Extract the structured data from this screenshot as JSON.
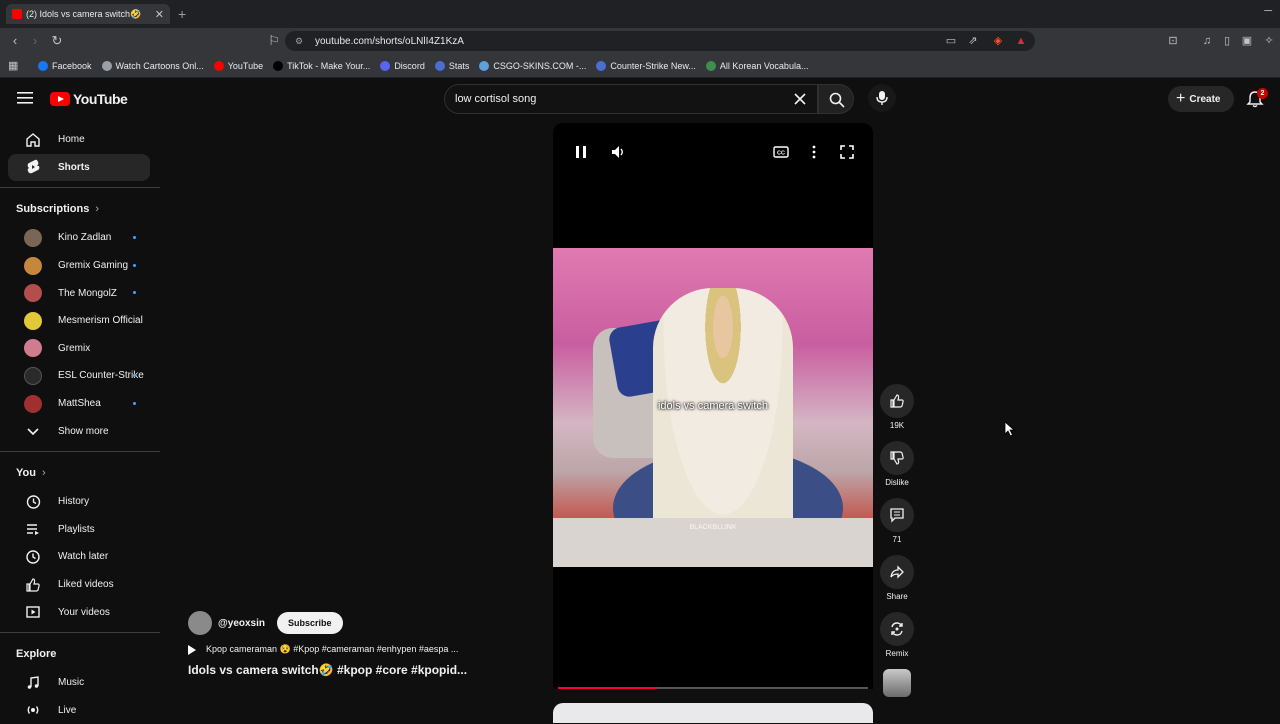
{
  "browser": {
    "tab_title": "(2) Idols vs camera switch🤣",
    "url": "youtube.com/shorts/oLNlI4Z1KzA",
    "bookmarks": [
      {
        "label": "Facebook",
        "color": "#1877f2"
      },
      {
        "label": "Watch Cartoons Onl...",
        "color": "#9aa0a6"
      },
      {
        "label": "YouTube",
        "color": "#ff0000"
      },
      {
        "label": "TikTok - Make Your...",
        "color": "#000000"
      },
      {
        "label": "Discord",
        "color": "#5865f2"
      },
      {
        "label": "Stats",
        "color": "#4a6fd1"
      },
      {
        "label": "CSGO-SKINS.COM -...",
        "color": "#5fa0d8"
      },
      {
        "label": "Counter-Strike New...",
        "color": "#4a6fd1"
      },
      {
        "label": "All Korean Vocabula...",
        "color": "#3d8f4f"
      }
    ]
  },
  "youtube": {
    "logo_text": "YouTube",
    "search_value": "low cortisol song",
    "create_label": "Create",
    "notif_count": "2",
    "nav": [
      {
        "label": "Home",
        "icon": "home-icon"
      },
      {
        "label": "Shorts",
        "icon": "shorts-icon"
      }
    ],
    "subscriptions_header": "Subscriptions",
    "subscriptions": [
      {
        "label": "Kino Zadlan",
        "color": "#7a6655"
      },
      {
        "label": "Gremix Gaming",
        "color": "#c6863c"
      },
      {
        "label": "The MongolZ",
        "color": "#b54d4d"
      },
      {
        "label": "Mesmerism Official",
        "color": "#e3c93a"
      },
      {
        "label": "Gremix",
        "color": "#d07c8e"
      },
      {
        "label": "ESL Counter-Strike",
        "color": "#2a2a2a"
      },
      {
        "label": "MattShea",
        "color": "#a03030"
      }
    ],
    "show_more": "Show more",
    "you_header": "You",
    "you_items": [
      {
        "label": "History",
        "icon": "history-icon"
      },
      {
        "label": "Playlists",
        "icon": "playlists-icon"
      },
      {
        "label": "Watch later",
        "icon": "watch-later-icon"
      },
      {
        "label": "Liked videos",
        "icon": "like-icon"
      },
      {
        "label": "Your videos",
        "icon": "your-videos-icon"
      }
    ],
    "explore_header": "Explore",
    "explore_items": [
      {
        "label": "Music",
        "icon": "music-icon"
      },
      {
        "label": "Live",
        "icon": "live-icon"
      }
    ]
  },
  "short": {
    "caption": "idols vs camera switch",
    "watermark": "BLACKBLLINK",
    "channel": "@yeoxsin",
    "subscribe_label": "Subscribe",
    "music_line": "Kpop cameraman 😵 #Kpop #cameraman #enhypen #aespa ...",
    "title": "Idols vs camera switch🤣 #kpop #core #kpopid...",
    "progress": 0.32,
    "actions": {
      "likes": "19K",
      "dislike": "Dislike",
      "comments": "71",
      "share": "Share",
      "remix": "Remix"
    }
  }
}
